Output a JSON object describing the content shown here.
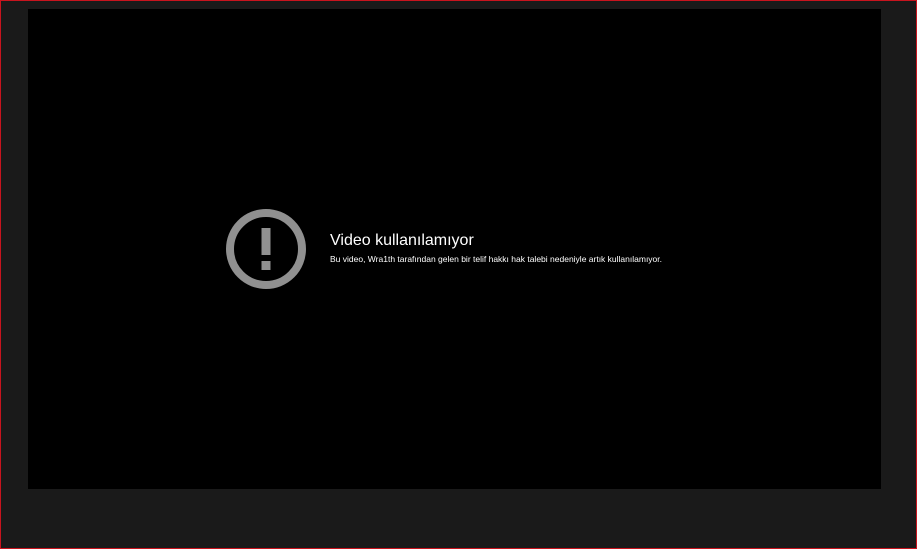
{
  "player": {
    "error": {
      "icon": "exclamation-circle-icon",
      "title": "Video kullanılamıyor",
      "reason": "Bu video, Wra1th tarafından gelen bir telif hakkı hak talebi nedeniyle artık kullanılamıyor."
    }
  },
  "colors": {
    "page_background": "#1a1a1a",
    "player_background": "#000000",
    "icon": "#909090",
    "text": "#ffffff",
    "frame_border": "#c8141e"
  }
}
